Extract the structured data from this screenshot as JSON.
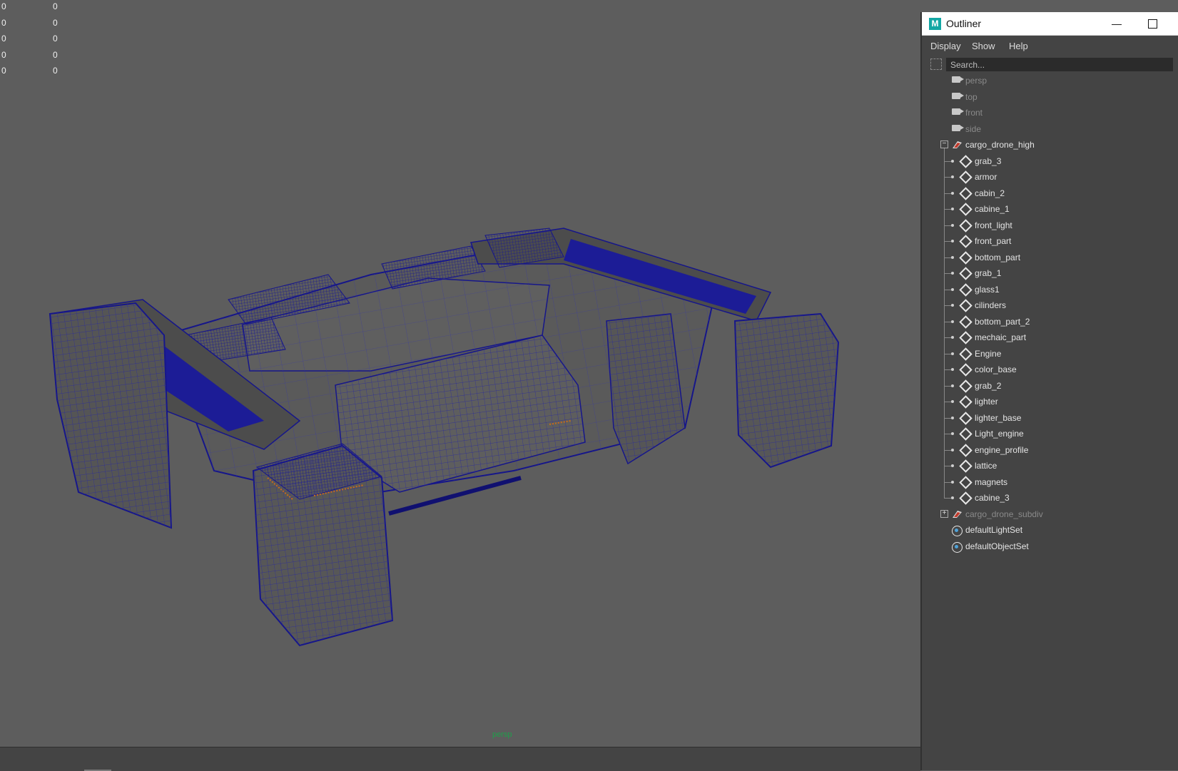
{
  "hud": {
    "rows": [
      {
        "left": "0",
        "right": "0"
      },
      {
        "left": "0",
        "right": "0"
      },
      {
        "left": "0",
        "right": "0"
      },
      {
        "left": "0",
        "right": "0"
      },
      {
        "left": "0",
        "right": "0"
      }
    ]
  },
  "viewport": {
    "camera_label": "persp"
  },
  "outliner": {
    "title": "Outliner",
    "logo": "M",
    "minimize_glyph": "—",
    "menu": [
      "Display",
      "Show",
      "Help"
    ],
    "search_placeholder": "Search...",
    "tree": [
      {
        "label": "persp",
        "icon": "camera-icon",
        "dim": true
      },
      {
        "label": "top",
        "icon": "camera-icon",
        "dim": true
      },
      {
        "label": "front",
        "icon": "camera-icon",
        "dim": true
      },
      {
        "label": "side",
        "icon": "camera-icon",
        "dim": true
      },
      {
        "label": "cargo_drone_high",
        "icon": "group-icon",
        "expanded": true
      },
      {
        "label": "grab_3",
        "icon": "mesh-icon",
        "child": true
      },
      {
        "label": "armor",
        "icon": "mesh-icon",
        "child": true
      },
      {
        "label": "cabin_2",
        "icon": "mesh-icon",
        "child": true
      },
      {
        "label": "cabine_1",
        "icon": "mesh-icon",
        "child": true
      },
      {
        "label": "front_light",
        "icon": "mesh-icon",
        "child": true
      },
      {
        "label": "front_part",
        "icon": "mesh-icon",
        "child": true
      },
      {
        "label": "bottom_part",
        "icon": "mesh-icon",
        "child": true
      },
      {
        "label": "grab_1",
        "icon": "mesh-icon",
        "child": true
      },
      {
        "label": "glass1",
        "icon": "mesh-icon",
        "child": true
      },
      {
        "label": "cilinders",
        "icon": "mesh-icon",
        "child": true
      },
      {
        "label": "bottom_part_2",
        "icon": "mesh-icon",
        "child": true
      },
      {
        "label": "mechaic_part",
        "icon": "mesh-icon",
        "child": true
      },
      {
        "label": "Engine",
        "icon": "mesh-icon",
        "child": true
      },
      {
        "label": "color_base",
        "icon": "mesh-icon",
        "child": true
      },
      {
        "label": "grab_2",
        "icon": "mesh-icon",
        "child": true
      },
      {
        "label": "lighter",
        "icon": "mesh-icon",
        "child": true
      },
      {
        "label": "lighter_base",
        "icon": "mesh-icon",
        "child": true
      },
      {
        "label": "Light_engine",
        "icon": "mesh-icon",
        "child": true
      },
      {
        "label": "engine_profile",
        "icon": "mesh-icon",
        "child": true
      },
      {
        "label": "lattice",
        "icon": "mesh-icon",
        "child": true
      },
      {
        "label": "magnets",
        "icon": "mesh-icon",
        "child": true
      },
      {
        "label": "cabine_3",
        "icon": "mesh-icon",
        "child": true
      },
      {
        "label": "cargo_drone_subdiv",
        "icon": "group-icon",
        "expanded": false,
        "dim": true
      },
      {
        "label": "defaultLightSet",
        "icon": "set-icon"
      },
      {
        "label": "defaultObjectSet",
        "icon": "set-icon"
      }
    ]
  },
  "colors": {
    "viewport_bg": "#5d5d5d",
    "wireframe": "#1a1a9a",
    "camera_label": "#1ea04a",
    "panel_bg": "#444444"
  }
}
